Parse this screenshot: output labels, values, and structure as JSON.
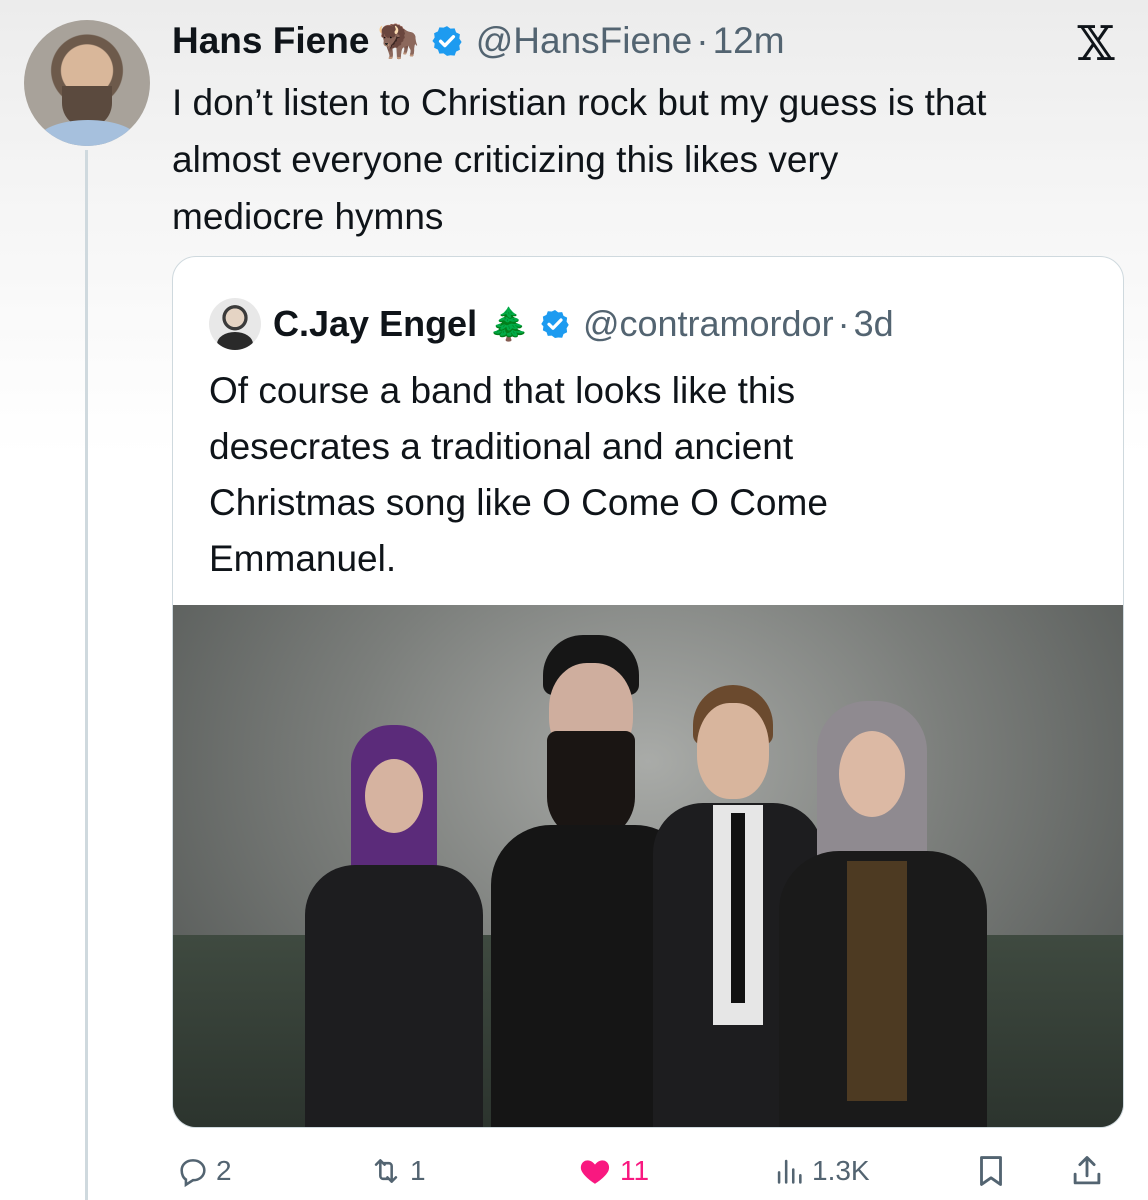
{
  "tweet": {
    "author_name": "Hans Fiene",
    "author_emoji": "🦬",
    "handle": "@HansFiene",
    "separator": "·",
    "time": "12m",
    "text_lines": [
      "I don’t listen to Christian rock but my guess is that",
      "almost everyone criticizing this likes very",
      "mediocre hymns"
    ]
  },
  "quoted": {
    "author_name": "C.Jay Engel",
    "author_emoji": "🌲",
    "handle": "@contramordor",
    "separator": "·",
    "time": "3d",
    "text_lines": [
      "Of course a band that looks like this",
      "desecrates a traditional and ancient",
      "Christmas song like O Come O Come",
      "Emmanuel."
    ]
  },
  "actions": {
    "replies": "2",
    "reposts": "1",
    "likes": "11",
    "views": "1.3K"
  },
  "colors": {
    "text": "#0f1419",
    "secondary": "#536471",
    "verified": "#1d9bf0",
    "like": "#f91880",
    "border": "#cfd9de"
  },
  "icons": [
    "x-logo-icon",
    "verified-badge-icon",
    "reply-icon",
    "repost-icon",
    "like-icon",
    "views-icon",
    "bookmark-icon",
    "share-icon"
  ]
}
